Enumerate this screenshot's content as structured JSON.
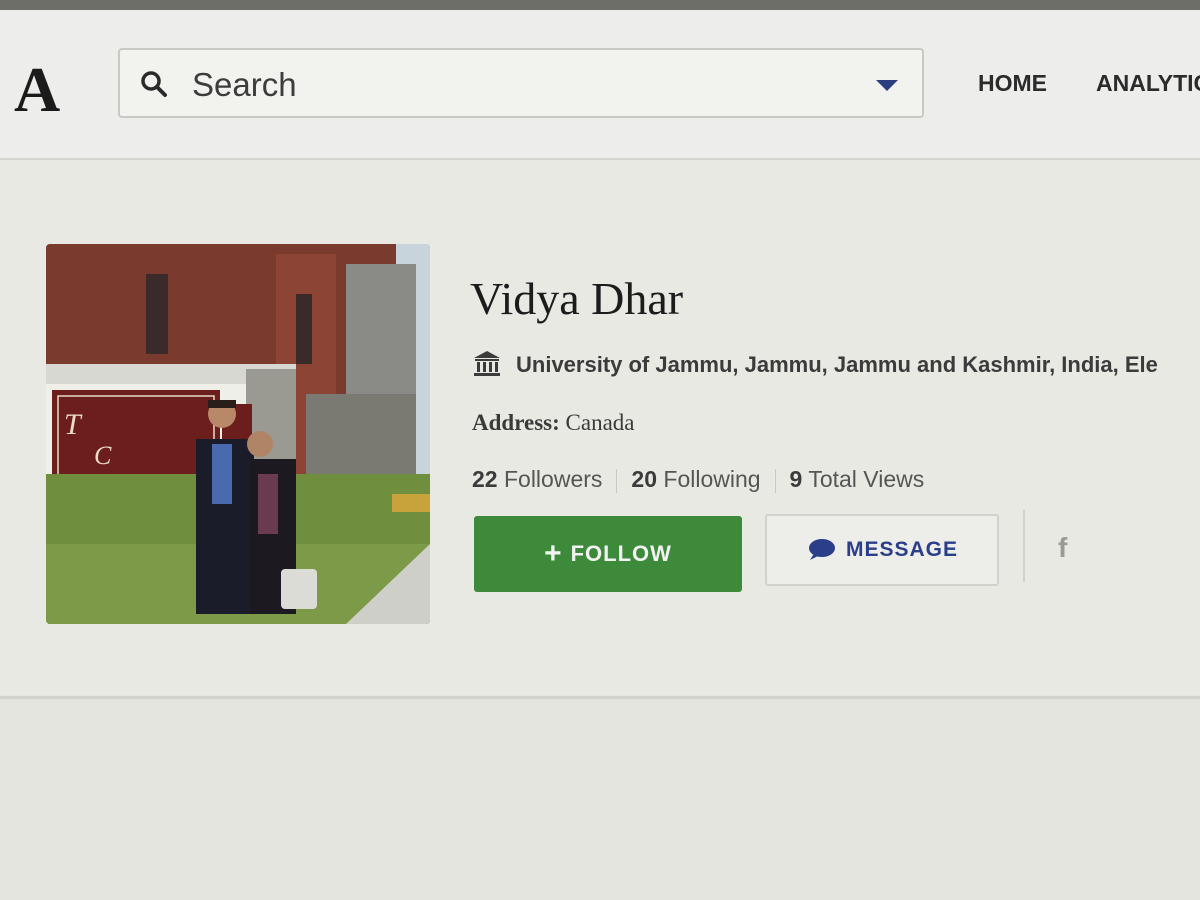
{
  "header": {
    "logo": "A",
    "search": {
      "placeholder": "Search"
    },
    "nav": [
      {
        "label": "HOME"
      },
      {
        "label": "ANALYTIC"
      }
    ]
  },
  "profile": {
    "name": "Vidya Dhar",
    "institution": "University of Jammu, Jammu, Jammu and Kashmir, India, Ele",
    "address_label": "Address:",
    "address_value": "Canada",
    "stats": {
      "followers_count": "22",
      "followers_label": "Followers",
      "following_count": "20",
      "following_label": "Following",
      "views_count": "9",
      "views_label": "Total Views"
    },
    "follow_label": "FOLLOW",
    "message_label": "MESSAGE",
    "social_icon": "f"
  },
  "colors": {
    "follow_green": "#3c8a3a",
    "message_blue": "#2b3e8a"
  }
}
